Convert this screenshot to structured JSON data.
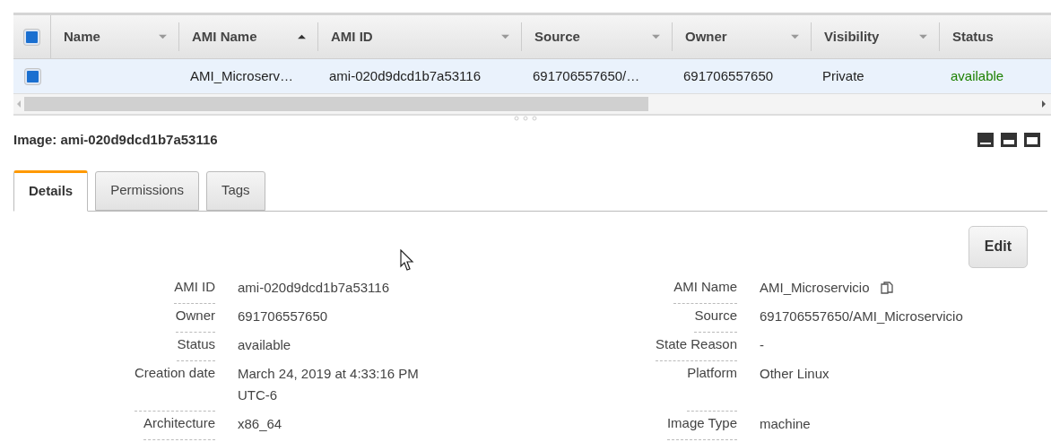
{
  "table": {
    "select_all": {
      "checked": true
    },
    "columns": [
      {
        "label": "Name",
        "kind": "sortable"
      },
      {
        "label": "AMI Name",
        "kind": "sorted"
      },
      {
        "label": "AMI ID",
        "kind": "sortable"
      },
      {
        "label": "Source",
        "kind": "sortable"
      },
      {
        "label": "Owner",
        "kind": "sortable"
      },
      {
        "label": "Visibility",
        "kind": "sortable"
      },
      {
        "label": "Status",
        "kind": "status"
      }
    ],
    "rows": [
      {
        "selected": true,
        "checked": true,
        "cells": [
          "",
          "AMI_Microserv…",
          "ami-020d9dcd1b7a53116",
          "691706557650/…",
          "691706557650",
          "Private",
          "available"
        ]
      }
    ]
  },
  "detail": {
    "title": "Image: ami-020d9dcd1b7a53116",
    "tabs": [
      {
        "label": "Details",
        "selected": true
      },
      {
        "label": "Permissions",
        "selected": false
      },
      {
        "label": "Tags",
        "selected": false
      }
    ],
    "edit_button": "Edit",
    "left_fields": [
      {
        "label": "AMI ID",
        "value": "ami-020d9dcd1b7a53116"
      },
      {
        "label": "Owner",
        "value": "691706557650"
      },
      {
        "label": "Status",
        "value": "available"
      },
      {
        "label": "Creation date",
        "value": "March 24, 2019 at 4:33:16 PM UTC-6"
      },
      {
        "label": "Architecture",
        "value": "x86_64"
      }
    ],
    "right_fields": [
      {
        "label": "AMI Name",
        "value": "AMI_Microservicio",
        "copyable": true
      },
      {
        "label": "Source",
        "value": "691706557650/AMI_Microservicio",
        "copyable": false
      },
      {
        "label": "State Reason",
        "value": "-",
        "copyable": false
      },
      {
        "label": "Platform",
        "value": "Other Linux",
        "copyable": false
      },
      {
        "label": "Image Type",
        "value": "machine",
        "copyable": false
      }
    ]
  }
}
